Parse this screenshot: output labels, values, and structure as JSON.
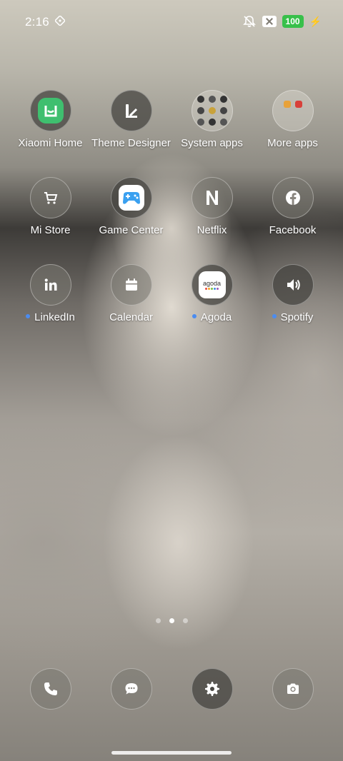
{
  "status": {
    "time": "2:16",
    "battery": "100",
    "icons": [
      "nfc-icon",
      "mute-icon",
      "no-sim-icon",
      "battery-icon",
      "charging-icon"
    ]
  },
  "apps": [
    {
      "label": "Xiaomi Home",
      "icon": "xiaomi-home-icon",
      "dot": false
    },
    {
      "label": "Theme Designer",
      "icon": "theme-designer-icon",
      "dot": false
    },
    {
      "label": "System apps",
      "icon": "folder-icon",
      "dot": false
    },
    {
      "label": "More apps",
      "icon": "folder-icon",
      "dot": false
    },
    {
      "label": "Mi Store",
      "icon": "cart-icon",
      "dot": false
    },
    {
      "label": "Game Center",
      "icon": "gamepad-icon",
      "dot": false
    },
    {
      "label": "Netflix",
      "icon": "netflix-icon",
      "dot": false
    },
    {
      "label": "Facebook",
      "icon": "facebook-icon",
      "dot": false
    },
    {
      "label": "LinkedIn",
      "icon": "linkedin-icon",
      "dot": true
    },
    {
      "label": "Calendar",
      "icon": "calendar-icon",
      "dot": false
    },
    {
      "label": "Agoda",
      "icon": "agoda-icon",
      "dot": true
    },
    {
      "label": "Spotify",
      "icon": "speaker-icon",
      "dot": true
    }
  ],
  "agoda_text": "agoda",
  "dock": [
    "phone-icon",
    "messages-icon",
    "settings-icon",
    "camera-icon"
  ],
  "pager": {
    "count": 3,
    "active": 2
  },
  "colors": {
    "notification_dot": "#4b8cf0",
    "battery": "#38c04a",
    "xiaomi_green": "#3fbf6f"
  }
}
